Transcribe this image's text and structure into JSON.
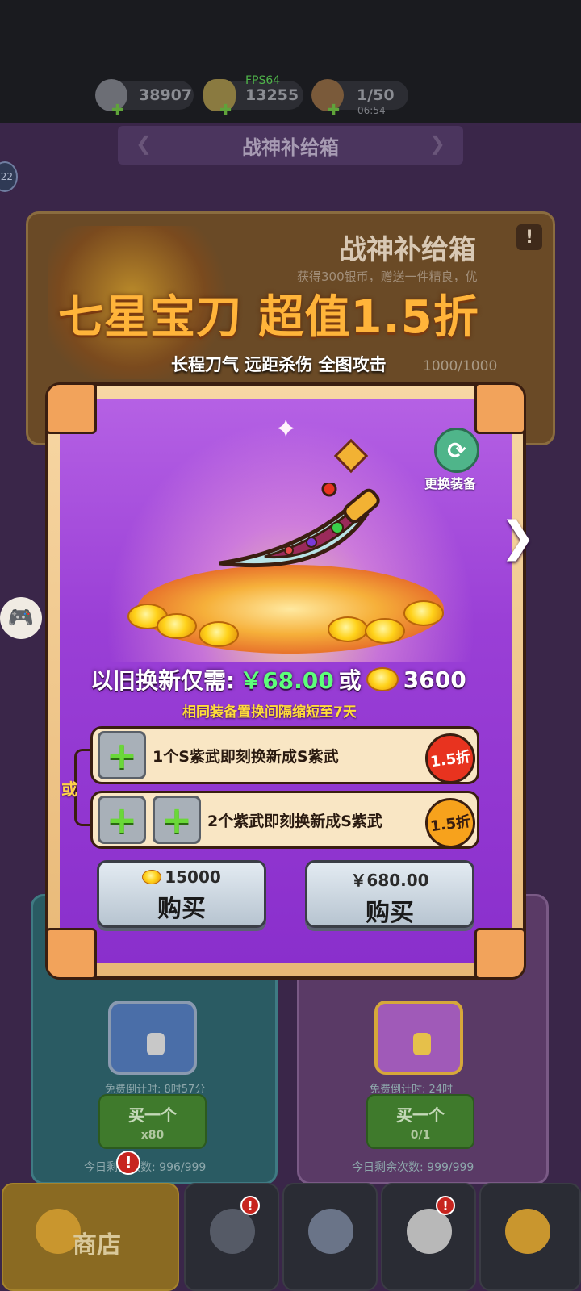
{
  "status": {
    "silver": "38907",
    "gold": "13255",
    "fps": "FPS64",
    "energy": "1/50",
    "timer": "06:54"
  },
  "page": {
    "title": "战神补给箱",
    "side_badge": "22"
  },
  "banner": {
    "title": "战神补给箱",
    "desc": "获得300银币，赠送一件精良，优",
    "promo": "七星宝刀 超值1.5折",
    "promo_sub": "长程刀气 远距杀伤 全图攻击",
    "counter": "1000/1000"
  },
  "modal": {
    "swap_label": "更换装备",
    "price_prefix": "以旧换新仅需:",
    "price_yuan": "￥68.00",
    "price_or": "或",
    "price_gold": "3600",
    "notice": "相同装备置换间隔缩短至7天",
    "or_label": "或",
    "options": [
      {
        "text": "1个S紫武即刻换新成S紫武",
        "discount": "1.5折"
      },
      {
        "text": "2个紫武即刻换新成S紫武",
        "discount": "1.5折"
      }
    ],
    "buy_gold": {
      "price": "15000",
      "label": "购买"
    },
    "buy_cash": {
      "price": "￥680.00",
      "label": "购买"
    }
  },
  "cards": {
    "left": {
      "free": "免费倒计时: 8时57分",
      "buy": "买一个",
      "cost": "x80",
      "remain": "今日剩余次数: 996/999"
    },
    "right": {
      "free": "免费倒计时: 24时",
      "buy": "买一个",
      "cost": "0/1",
      "remain": "今日剩余次数: 999/999"
    }
  },
  "nav": {
    "shop": "商店",
    "badge": "!"
  },
  "colors": {
    "accent_gold": "#ffb43a",
    "modal_purple": "#9a3fd6",
    "price_green": "#5dff7a"
  }
}
